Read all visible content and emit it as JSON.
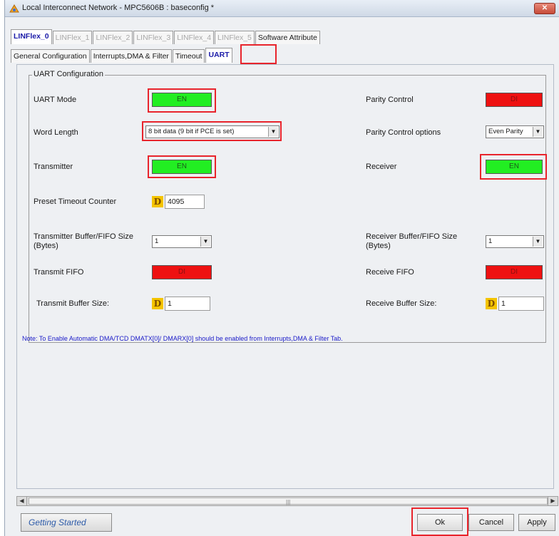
{
  "window": {
    "title": "Local Interconnect Network - MPC5606B : baseconfig *",
    "close_label": "✕"
  },
  "tabs_top": [
    {
      "label": "LINFlex_0",
      "state": "active"
    },
    {
      "label": "LINFlex_1",
      "state": "disabled"
    },
    {
      "label": "LINFlex_2",
      "state": "disabled"
    },
    {
      "label": "LINFlex_3",
      "state": "disabled"
    },
    {
      "label": "LINFlex_4",
      "state": "disabled"
    },
    {
      "label": "LINFlex_5",
      "state": "disabled"
    },
    {
      "label": "Software Attribute",
      "state": "normal"
    }
  ],
  "tabs_sub": [
    {
      "label": "General Configuration",
      "state": "normal"
    },
    {
      "label": "Interrupts,DMA & Filter",
      "state": "normal"
    },
    {
      "label": "Timeout",
      "state": "normal"
    },
    {
      "label": "UART",
      "state": "active"
    }
  ],
  "uart": {
    "group_title": "UART Configuration",
    "uart_mode": {
      "label": "UART Mode",
      "value": "EN"
    },
    "parity_control": {
      "label": "Parity Control",
      "value": "DI"
    },
    "word_length": {
      "label": "Word Length",
      "value": "8 bit data (9 bit if PCE is set)"
    },
    "parity_options": {
      "label": "Parity Control options",
      "value": "Even Parity"
    },
    "transmitter": {
      "label": "Transmitter",
      "value": "EN"
    },
    "receiver": {
      "label": "Receiver",
      "value": "EN"
    },
    "preset_timeout": {
      "label": "Preset Timeout Counter",
      "value": "4095"
    },
    "tx_buffer_fifo_size": {
      "label": "Transmitter Buffer/FIFO Size (Bytes)",
      "value": "1"
    },
    "rx_buffer_fifo_size": {
      "label": "Receiver Buffer/FIFO Size (Bytes)",
      "value": "1"
    },
    "transmit_fifo": {
      "label": "Transmit  FIFO",
      "value": "DI"
    },
    "receive_fifo": {
      "label": "Receive FIFO",
      "value": "DI"
    },
    "transmit_buffer_size": {
      "label": "Transmit Buffer Size:",
      "value": "1"
    },
    "receive_buffer_size": {
      "label": "Receive Buffer Size:",
      "value": "1"
    },
    "note": "Note: To Enable Automatic DMA/TCD DMATX[0]/ DMARX[0] should be enabled from Interrupts,DMA & Filter Tab."
  },
  "badge_letter": "D",
  "footer": {
    "getting_started": "Getting Started",
    "ok": "Ok",
    "cancel": "Cancel",
    "apply": "Apply"
  },
  "colors": {
    "enabled": "#22ee22",
    "disabled": "#ee1111",
    "highlight": "#e8242c",
    "active_tab_text": "#1a1aa8"
  }
}
